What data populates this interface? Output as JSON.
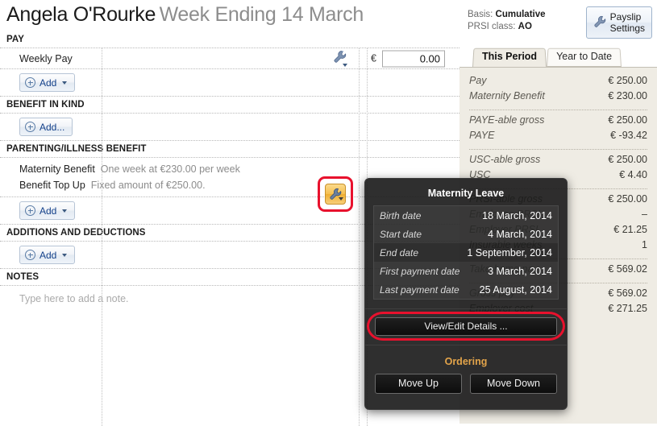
{
  "employee": {
    "name": "Angela O'Rourke",
    "period": "Week Ending 14 March"
  },
  "sections": {
    "pay": {
      "title": "PAY",
      "item_label": "Weekly Pay",
      "currency": "€",
      "amount_value": "0.00",
      "amount_placeholder": "0.00",
      "add_label": "Add"
    },
    "benefit_in_kind": {
      "title": "BENEFIT IN KIND",
      "add_label": "Add..."
    },
    "parenting": {
      "title": "PARENTING/ILLNESS BENEFIT",
      "rows": [
        {
          "label": "Maternity Benefit",
          "desc": "One week at €230.00 per week"
        },
        {
          "label": "Benefit Top Up",
          "desc": "Fixed amount of €250.00."
        }
      ],
      "add_label": "Add"
    },
    "additions": {
      "title": "ADDITIONS AND DEDUCTIONS",
      "add_label": "Add"
    },
    "notes": {
      "title": "NOTES",
      "placeholder": "Type here to add a note."
    }
  },
  "summary": {
    "basis_label": "Basis:",
    "basis_value": "Cumulative",
    "prsi_label": "PRSI class:",
    "prsi_value": "AO",
    "settings_button": "Payslip\nSettings",
    "settings_button_line1": "Payslip",
    "settings_button_line2": "Settings",
    "tabs": [
      {
        "label": "This Period",
        "active": true
      },
      {
        "label": "Year to Date",
        "active": false
      }
    ],
    "groups": [
      {
        "rows": [
          {
            "label": "Pay",
            "value": "€ 250.00"
          },
          {
            "label": "Maternity Benefit",
            "value": "€ 230.00"
          }
        ]
      },
      {
        "rows": [
          {
            "label": "PAYE-able gross",
            "value": "€ 250.00"
          },
          {
            "label": "PAYE",
            "value": "€ -93.42"
          }
        ]
      },
      {
        "rows": [
          {
            "label": "USC-able gross",
            "value": "€ 250.00"
          },
          {
            "label": "USC",
            "value": "€ 4.40"
          }
        ]
      },
      {
        "rows": [
          {
            "label": "PRSI-able gross",
            "value": "€ 250.00"
          },
          {
            "label": "Employee PRSI",
            "value": "–"
          },
          {
            "label": "Employer PRSI",
            "value": "€ 21.25"
          },
          {
            "label": "Insurable weeks",
            "value": "1"
          }
        ]
      },
      {
        "rows": [
          {
            "label": "Take-home pay",
            "value": "€ 569.02"
          }
        ]
      },
      {
        "rows": [
          {
            "label": "Gross pay",
            "value": "€ 569.02"
          },
          {
            "label": "Employer cost",
            "value": "€ 271.25"
          }
        ]
      }
    ]
  },
  "popup": {
    "title": "Maternity Leave",
    "rows": [
      {
        "key": "Birth date",
        "value": "18 March, 2014"
      },
      {
        "key": "Start date",
        "value": "4 March, 2014"
      },
      {
        "key": "End date",
        "value": "1 September, 2014"
      },
      {
        "key": "First payment date",
        "value": "3 March, 2014"
      },
      {
        "key": "Last payment date",
        "value": "25 August, 2014"
      }
    ],
    "view_edit_button": "View/Edit Details ...",
    "ordering_title": "Ordering",
    "move_up_button": "Move Up",
    "move_down_button": "Move Down"
  },
  "colors": {
    "annotation_red": "#e8112d",
    "wrench_amber": "#f5bf50",
    "ordering_orange": "#e3a44a",
    "panel_beige": "#efece4"
  }
}
